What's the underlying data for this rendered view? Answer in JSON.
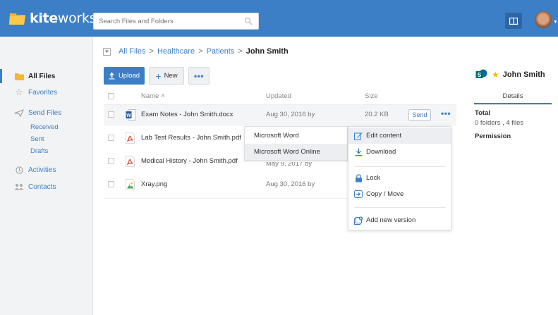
{
  "app": {
    "logo_text_bold": "kite",
    "logo_text_rest": "works"
  },
  "search": {
    "placeholder": "Search Files and Folders"
  },
  "sidebar": {
    "all_files": "All Files",
    "favorites": "Favorites",
    "send_files": "Send Files",
    "received": "Received",
    "sent": "Sent",
    "drafts": "Drafts",
    "activities": "Activities",
    "contacts": "Contacts"
  },
  "breadcrumb": {
    "items": [
      "All Files",
      "Healthcare",
      "Patients"
    ],
    "separator": ">",
    "current": "John Smith"
  },
  "toolbar": {
    "upload": "Upload",
    "new": "New",
    "more": "•••"
  },
  "table": {
    "headers": {
      "name": "Name",
      "sort": "˄",
      "updated": "Updated",
      "size": "Size"
    },
    "rows": [
      {
        "name": "Exam Notes - John Smith.docx",
        "updated": "Aug 30, 2016 by",
        "size": "20.2 KB",
        "icon": "word-doc-icon"
      },
      {
        "name": "Lab Test Results - John Smith.pdf",
        "updated": "",
        "size": "",
        "icon": "pdf-icon"
      },
      {
        "name": "Medical History - John Smith.pdf",
        "updated": "May 9, 2017 by",
        "size": "",
        "icon": "pdf-icon"
      },
      {
        "name": "Xray.png",
        "updated": "Aug 30, 2016 by",
        "size": "",
        "icon": "image-icon"
      }
    ],
    "send_label": "Send",
    "more_label": "•••"
  },
  "submenu": {
    "items": [
      "Microsoft Word",
      "Microsoft Word Online"
    ]
  },
  "context_menu": {
    "items": [
      "Edit content",
      "Download",
      "Lock",
      "Copy / Move",
      "Add new version"
    ]
  },
  "details_panel": {
    "title": "John Smith",
    "tab": "Details",
    "total_label": "Total",
    "counts": "0 folders , 4 files",
    "permission_label": "Permission"
  },
  "colors": {
    "brand": "#3c7fc6",
    "logo_folder": "#f7b731",
    "pdf": "#e0442f",
    "word": "#2b5797",
    "star": "#f5b800"
  }
}
